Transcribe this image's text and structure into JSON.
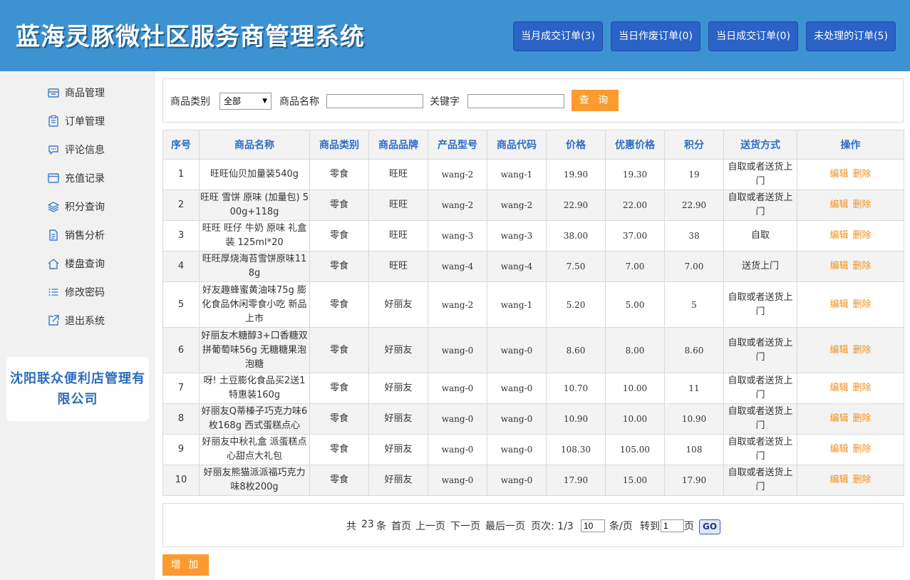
{
  "header": {
    "title": "蓝海灵豚微社区服务商管理系统",
    "buttons": [
      "当月成交订单(3)",
      "当日作废订单(0)",
      "当日成交订单(0)",
      "未处理的订单(5)"
    ]
  },
  "sidebar": {
    "items": [
      {
        "label": "商品管理",
        "icon": "goods-icon"
      },
      {
        "label": "订单管理",
        "icon": "clipboard-icon"
      },
      {
        "label": "评论信息",
        "icon": "chat-icon"
      },
      {
        "label": "充值记录",
        "icon": "window-icon"
      },
      {
        "label": "积分查询",
        "icon": "layers-icon"
      },
      {
        "label": "销售分析",
        "icon": "document-icon"
      },
      {
        "label": "楼盘查询",
        "icon": "home-icon"
      },
      {
        "label": "修改密码",
        "icon": "list-icon"
      },
      {
        "label": "退出系统",
        "icon": "external-link-icon"
      }
    ],
    "company": "沈阳联众便利店管理有限公司"
  },
  "search": {
    "category_label": "商品类别",
    "category_value": "全部",
    "name_label": "商品名称",
    "name_value": "",
    "keyword_label": "关键字",
    "keyword_value": "",
    "query_button": "查 询"
  },
  "table": {
    "headers": [
      "序号",
      "商品名称",
      "商品类别",
      "商品品牌",
      "产品型号",
      "商品代码",
      "价格",
      "优惠价格",
      "积分",
      "送货方式",
      "操作"
    ],
    "edit_label": "编辑",
    "delete_label": "删除",
    "rows": [
      {
        "no": "1",
        "name": "旺旺仙贝加量装540g",
        "category": "零食",
        "brand": "旺旺",
        "model": "wang-2",
        "code": "wang-1",
        "price": "19.90",
        "discount": "19.30",
        "points": "19",
        "delivery": "自取或者送货上门"
      },
      {
        "no": "2",
        "name": "旺旺 雪饼 原味 (加量包) 500g+118g",
        "category": "零食",
        "brand": "旺旺",
        "model": "wang-2",
        "code": "wang-2",
        "price": "22.90",
        "discount": "22.00",
        "points": "22.90",
        "delivery": "自取或者送货上门"
      },
      {
        "no": "3",
        "name": "旺旺 旺仔 牛奶 原味 礼盒装 125ml*20",
        "category": "零食",
        "brand": "旺旺",
        "model": "wang-3",
        "code": "wang-3",
        "price": "38.00",
        "discount": "37.00",
        "points": "38",
        "delivery": "自取"
      },
      {
        "no": "4",
        "name": "旺旺厚烧海苔雪饼原味118g",
        "category": "零食",
        "brand": "旺旺",
        "model": "wang-4",
        "code": "wang-4",
        "price": "7.50",
        "discount": "7.00",
        "points": "7.00",
        "delivery": "送货上门"
      },
      {
        "no": "5",
        "name": "好友趣蜂蜜黄油味75g 膨化食品休闲零食小吃 新品上市",
        "category": "零食",
        "brand": "好丽友",
        "model": "wang-2",
        "code": "wang-1",
        "price": "5.20",
        "discount": "5.00",
        "points": "5",
        "delivery": "自取或者送货上门"
      },
      {
        "no": "6",
        "name": "好丽友木糖醇3+口香糖双拼葡萄味56g 无糖糖果泡泡糖",
        "category": "零食",
        "brand": "好丽友",
        "model": "wang-0",
        "code": "wang-0",
        "price": "8.60",
        "discount": "8.00",
        "points": "8.60",
        "delivery": "自取或者送货上门"
      },
      {
        "no": "7",
        "name": "呀! 土豆膨化食品买2送1特惠装160g",
        "category": "零食",
        "brand": "好丽友",
        "model": "wang-0",
        "code": "wang-0",
        "price": "10.70",
        "discount": "10.00",
        "points": "11",
        "delivery": "自取或者送货上门"
      },
      {
        "no": "8",
        "name": "好丽友Q蒂榛子巧克力味6枚168g 西式蛋糕点心",
        "category": "零食",
        "brand": "好丽友",
        "model": "wang-0",
        "code": "wang-0",
        "price": "10.90",
        "discount": "10.00",
        "points": "10.90",
        "delivery": "自取或者送货上门"
      },
      {
        "no": "9",
        "name": "好丽友中秋礼盒 派蛋糕点心甜点大礼包",
        "category": "零食",
        "brand": "好丽友",
        "model": "wang-0",
        "code": "wang-0",
        "price": "108.30",
        "discount": "105.00",
        "points": "108",
        "delivery": "自取或者送货上门"
      },
      {
        "no": "10",
        "name": "好丽友熊猫派派福巧克力味8枚200g",
        "category": "零食",
        "brand": "好丽友",
        "model": "wang-0",
        "code": "wang-0",
        "price": "17.90",
        "discount": "15.00",
        "points": "17.90",
        "delivery": "自取或者送货上门"
      }
    ]
  },
  "pager": {
    "total_prefix": "共",
    "total_count": "23",
    "total_suffix": "条",
    "first": "首页",
    "prev": "上一页",
    "next": "下一页",
    "last": "最后一页",
    "page_info": "页次: 1/3",
    "page_size": "10",
    "per_page_label": "条/页",
    "goto_label": "转到",
    "goto_value": "1",
    "page_unit": "页",
    "go_button": "GO"
  },
  "add_button": "增 加",
  "colors": {
    "header_bg": "#3d93d1",
    "header_button": "#2a62c6",
    "accent_orange": "#fb9b2f",
    "table_header_text": "#2e6cc7",
    "company_text": "#2b6dbc",
    "action_link": "#f0911f"
  }
}
